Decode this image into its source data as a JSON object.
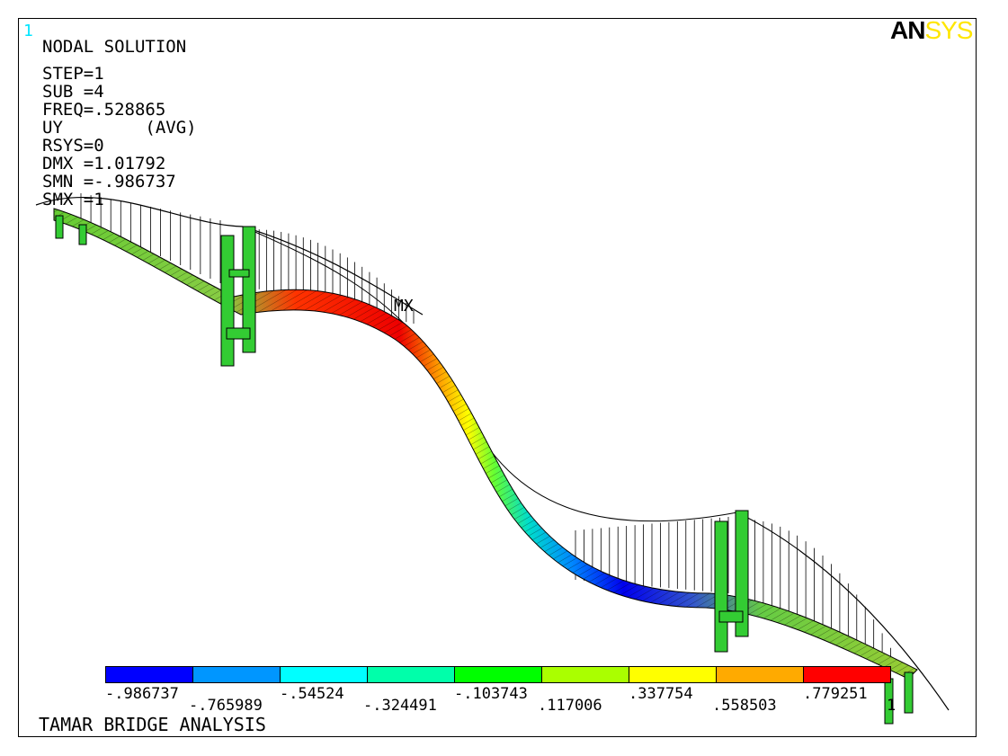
{
  "window_number": "1",
  "logo": {
    "part1": "AN",
    "part2": "SYS"
  },
  "info_lines": [
    "NODAL SOLUTION",
    "STEP=1",
    "SUB =4",
    "FREQ=.528865",
    "UY        (AVG)",
    "RSYS=0",
    "DMX =1.01792",
    "SMN =-.986737",
    "SMX =1"
  ],
  "max_marker": "MX",
  "legend": {
    "colors": [
      "#0000ff",
      "#0096ff",
      "#00ffff",
      "#00ffaa",
      "#00ff00",
      "#aaff00",
      "#ffff00",
      "#ffaa00",
      "#ff0000"
    ],
    "labels": [
      "-.986737",
      "-.765989",
      "-.54524",
      "-.324491",
      "-.103743",
      ".117006",
      ".337754",
      ".558503",
      ".779251",
      "1"
    ]
  },
  "footer_title": "TAMAR BRIDGE ANALYSIS"
}
